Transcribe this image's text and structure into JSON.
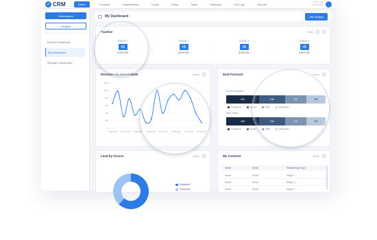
{
  "topnav": {
    "brand": "CRM",
    "items": [
      {
        "label": "Home",
        "active": true
      },
      {
        "label": "Contacts",
        "active": false
      },
      {
        "label": "Organizations",
        "active": false
      },
      {
        "label": "Leads",
        "active": false
      },
      {
        "label": "Deals",
        "active": false
      },
      {
        "label": "Tasks",
        "active": false
      },
      {
        "label": "Meetings",
        "active": false
      },
      {
        "label": "Call Logs",
        "active": false
      },
      {
        "label": "Reports",
        "active": false
      }
    ],
    "user_name": "Admin User",
    "user_role": "Administrator"
  },
  "sidebar": {
    "primary_button": "Dashboards",
    "secondary_button": "Widgets",
    "items": [
      {
        "label": "Default Dashboard",
        "active": false
      },
      {
        "label": "My Dashboard",
        "active": true
      },
      {
        "label": "Manager Dashboard",
        "active": false
      }
    ]
  },
  "header": {
    "title": "My Dashboard",
    "action_button": "Add Widget"
  },
  "pipeline": {
    "title": "Pipeline",
    "filter_label": "Week",
    "stages": [
      {
        "label": "STAGE 1",
        "count": "+5",
        "amount": "$ 600,000"
      },
      {
        "label": "STAGE 2",
        "count": "+5",
        "amount": "$ 600,000"
      },
      {
        "label": "STAGE 3",
        "count": "+5",
        "amount": "$ 600,000"
      },
      {
        "label": "STAGE 4",
        "count": "+5",
        "amount": "$ 600,000"
      }
    ]
  },
  "revenue": {
    "title": "Revenue via closed deals",
    "filter_label": "Month"
  },
  "forecast": {
    "title": "Deal Forecast",
    "filter_label": "Month",
    "rows": [
      {
        "label": "Current Pipeline",
        "segments": [
          {
            "value": "150",
            "color": "#1a2b47",
            "fraction": 0.33
          },
          {
            "value": "156",
            "color": "#3e5c82",
            "fraction": 0.26
          },
          {
            "value": "112",
            "color": "#7d93b2",
            "fraction": 0.22
          },
          {
            "value": "180",
            "color": "#b8c8dc",
            "fraction": 0.19
          }
        ]
      },
      {
        "label": "Won Deals",
        "segments": [
          {
            "value": "150",
            "color": "#1a2b47",
            "fraction": 0.33
          },
          {
            "value": "156",
            "color": "#3e5c82",
            "fraction": 0.26
          },
          {
            "value": "112",
            "color": "#7d93b2",
            "fraction": 0.22
          },
          {
            "value": "180",
            "color": "#b8c8dc",
            "fraction": 0.19
          }
        ]
      }
    ],
    "legend": [
      {
        "label": "Completed",
        "color": "#1a2b47"
      },
      {
        "label": "Closed",
        "color": "#3e5c82"
      },
      {
        "label": "ToDo",
        "color": "#7d93b2"
      },
      {
        "label": "InProgress",
        "color": "#b8c8dc"
      }
    ]
  },
  "lead_source": {
    "title": "Lead by Source",
    "filter_label": "Month",
    "legend": [
      {
        "label": "Instagram",
        "color": "#2d7be5"
      },
      {
        "label": "Facebook",
        "color": "#9cc3f5"
      }
    ],
    "fractions": [
      0.62,
      0.38
    ]
  },
  "contacts": {
    "title": "My Contacts",
    "filter_label": "Month",
    "columns": [
      "Name",
      "Email",
      "Relationship Type"
    ],
    "rows": [
      [
        "Name",
        "Email",
        "Stage 1"
      ],
      [
        "Name",
        "Email",
        "Stage 2"
      ],
      [
        "Name",
        "Email",
        "Stage 3"
      ]
    ]
  },
  "chart_data": {
    "type": "line",
    "title": "Revenue via closed deals",
    "x": [
      "10:30 PM",
      "10:30 PM",
      "10:30 PM",
      "10:30 PM",
      "10:30 PM",
      "10:30 PM",
      "10:30 PM",
      "10:30 PM",
      "10:30 PM",
      "10:30 PM",
      "10:30 PM",
      "10:30 PM",
      "10:30 PM",
      "10:30 PM",
      "10:30 PM",
      "10:30 PM",
      "10:30 PM"
    ],
    "x_tick_labels": [
      "10:30 PM",
      "10:30 PM",
      "10:30 PM",
      "10:30 PM",
      "10:30 PM",
      "10:30 PM",
      "10:30 PM",
      "10:30 PM"
    ],
    "series": [
      {
        "values": [
          650,
          980,
          300,
          780,
          350,
          500,
          150,
          250,
          1000,
          400,
          750,
          900,
          750,
          1000,
          800,
          400,
          150
        ]
      }
    ],
    "y_ticks": [
      "1200",
      "1000",
      "800",
      "600",
      "400",
      "200",
      "0"
    ],
    "ylim": [
      0,
      1200
    ],
    "color": "#2d7be5",
    "grid": true
  }
}
